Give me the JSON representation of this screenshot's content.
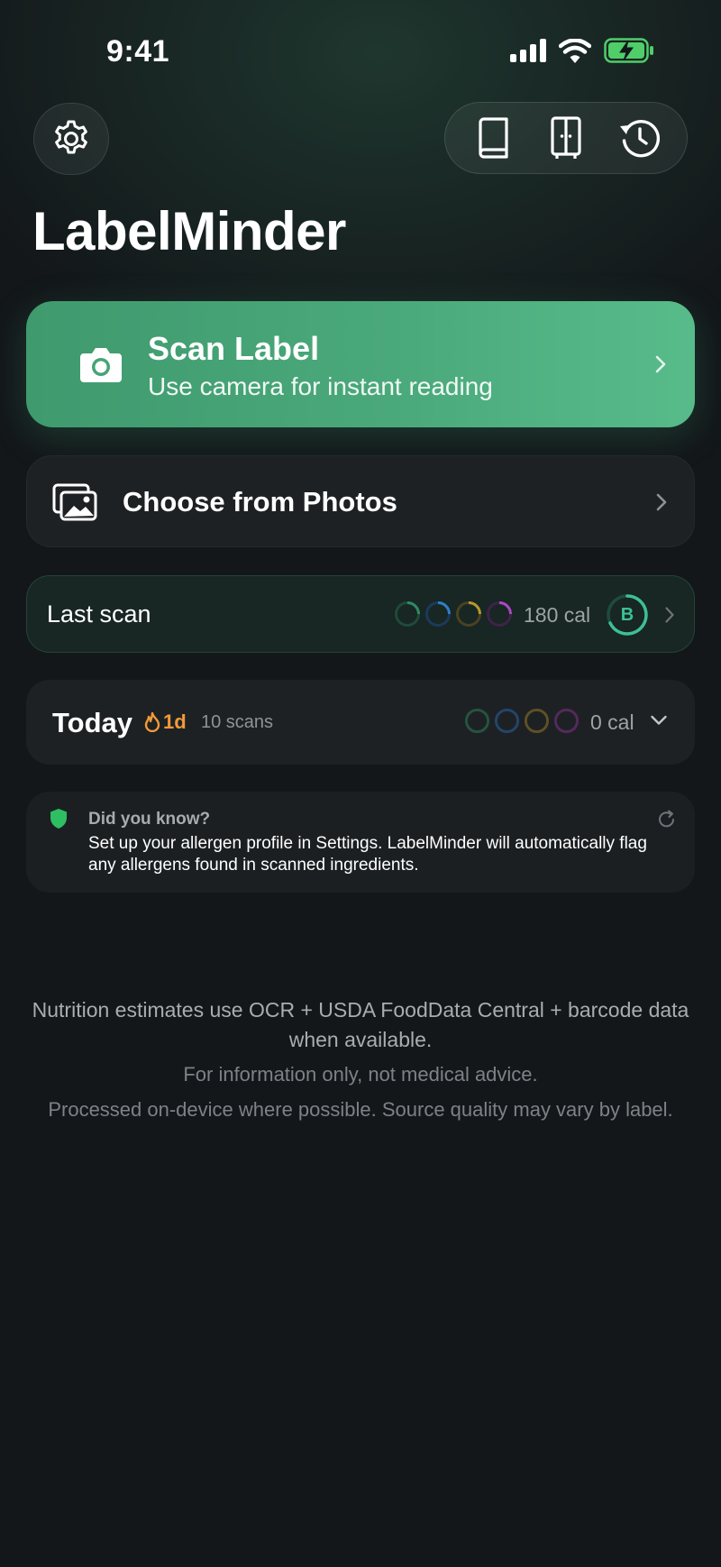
{
  "status_bar": {
    "time": "9:41"
  },
  "app": {
    "title": "LabelMinder"
  },
  "icons": {
    "settings": "gear-icon",
    "library": "book-icon",
    "pantry": "cabinet-icon",
    "history": "history-icon",
    "camera": "camera-icon",
    "photos": "photos-icon",
    "chevron": "chevron-right-icon",
    "tip": "shield-icon"
  },
  "scan": {
    "title": "Scan Label",
    "subtitle": "Use camera for instant reading"
  },
  "photos": {
    "title": "Choose from Photos"
  },
  "last_scan": {
    "label": "Last scan",
    "calories": "180 cal",
    "grade": "B"
  },
  "today": {
    "label": "Today",
    "streak": "1d",
    "scans": "10 scans",
    "calories": "0 cal"
  },
  "tip": {
    "heading": "Did you know?",
    "body": "Set up your allergen profile in Settings. LabelMinder will automatically flag any allergens found in scanned ingredients."
  },
  "footer": {
    "line1": "Nutrition estimates use OCR + USDA FoodData Central + barcode data when available.",
    "line2": "For information only, not medical advice.",
    "line3": "Processed on-device where possible. Source quality may vary by label."
  },
  "colors": {
    "accent": "#4aa97b",
    "ring_green": "#2f8a63",
    "ring_blue": "#2f7fc8",
    "ring_yellow": "#b59a2a",
    "ring_purple": "#a94ac2",
    "streak": "#f29a38",
    "grade": "#3dbf97"
  }
}
